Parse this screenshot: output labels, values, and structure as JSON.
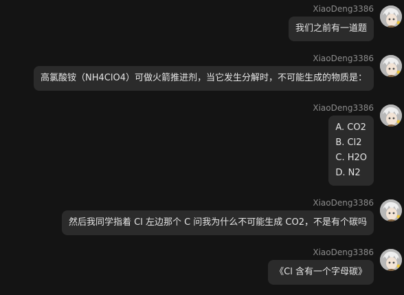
{
  "messages": [
    {
      "user": "XiaoDeng3386",
      "lines": [
        "我们之前有一道题"
      ]
    },
    {
      "user": "XiaoDeng3386",
      "lines": [
        "高氯酸铵（NH4ClO4）可做火箭推进剂，当它发生分解时，不可能生成的物质是："
      ]
    },
    {
      "user": "XiaoDeng3386",
      "lines": [
        "A. CO2",
        "B. Cl2",
        "C. H2O",
        "D. N2"
      ]
    },
    {
      "user": "XiaoDeng3386",
      "lines": [
        "然后我同学指着 Cl 左边那个 C 问我为什么不可能生成 CO2，不是有个碳吗"
      ]
    },
    {
      "user": "XiaoDeng3386",
      "lines": [
        "《Cl 含有一个字母碳》"
      ]
    }
  ],
  "avatar_icon": "anime-avatar-icon",
  "colors": {
    "background": "#141414",
    "bubble": "#2b2b2b",
    "text": "#e6e6e6",
    "username": "#8c8c8c"
  }
}
